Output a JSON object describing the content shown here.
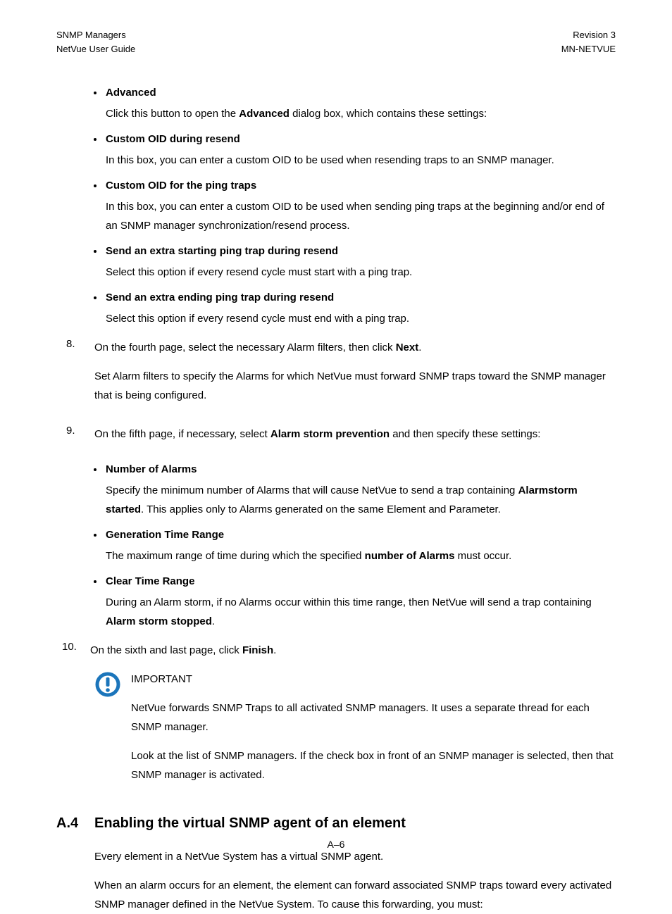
{
  "header": {
    "left1": "SNMP Managers",
    "left2": "NetVue User Guide",
    "right1": "Revision 3",
    "right2": "MN-NETVUE"
  },
  "bullets1": [
    {
      "title": "Advanced",
      "body_pre": "Click this button to open the ",
      "body_bold": "Advanced",
      "body_post": " dialog box, which contains these settings:"
    },
    {
      "title": "Custom OID during resend",
      "body": "In this box, you can enter a custom OID to be used when resending traps to an SNMP manager."
    },
    {
      "title": "Custom OID for the ping traps",
      "body": "In this box, you can enter a custom OID to be used when sending ping traps at the beginning and/or end of an SNMP manager synchronization/resend process."
    },
    {
      "title": "Send an extra starting ping trap during resend",
      "body": "Select this option if every resend cycle must start with a ping trap."
    },
    {
      "title": "Send an extra ending ping trap during resend",
      "body": "Select this option if every resend cycle must end with a ping trap."
    }
  ],
  "step8": {
    "num": "8.",
    "line1_pre": "On the fourth page, select the necessary Alarm filters, then click ",
    "line1_bold": "Next",
    "line1_post": ".",
    "line2": "Set Alarm filters to specify the Alarms for which NetVue must forward SNMP traps toward the SNMP manager that is being configured."
  },
  "step9": {
    "num": "9.",
    "line1_pre": "On the fifth page, if necessary, select ",
    "line1_bold": "Alarm storm prevention",
    "line1_post": " and then specify these settings:"
  },
  "bullets2": [
    {
      "title": "Number of Alarms",
      "body_pre": "Specify the minimum number of Alarms that will cause NetVue to send a trap containing ",
      "body_bold": "Alarmstorm started",
      "body_post": ". This applies only to Alarms generated on the same Element and Parameter."
    },
    {
      "title": "Generation Time Range",
      "body_pre": "The maximum range of time during which the specified ",
      "body_bold": "number of Alarms",
      "body_post": " must occur."
    },
    {
      "title": "Clear Time Range",
      "body_pre": "During an Alarm storm, if no Alarms occur within this time range, then NetVue will send a trap containing ",
      "body_bold": "Alarm storm stopped",
      "body_post": "."
    }
  ],
  "step10": {
    "num": "10.",
    "line_pre": "On the sixth and last page, click ",
    "line_bold": "Finish",
    "line_post": "."
  },
  "important": {
    "label": "IMPORTANT",
    "p1": "NetVue forwards SNMP Traps to all activated SNMP managers. It uses a separate thread for each SNMP manager.",
    "p2": "Look at the list of SNMP managers. If the check box in front of an SNMP manager is selected, then that SNMP manager is activated."
  },
  "section": {
    "num": "A.4",
    "title": "Enabling the virtual SNMP agent of an element",
    "p1": "Every element in a NetVue System has a virtual SNMP agent.",
    "p2": "When an alarm occurs for an element, the element can forward associated SNMP traps toward every activated SNMP manager defined in the NetVue System. To cause this forwarding, you must:"
  },
  "page_num": "A–6"
}
